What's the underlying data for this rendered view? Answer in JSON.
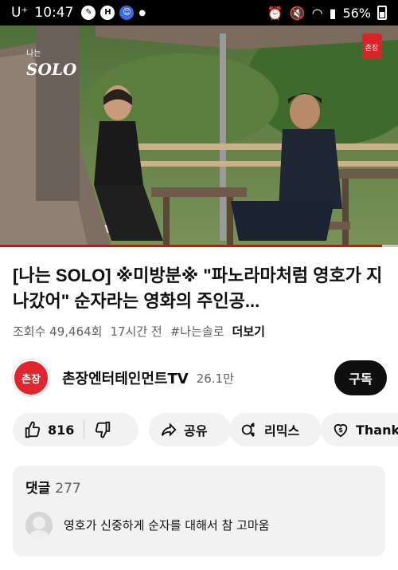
{
  "status_bar": {
    "carrier": "U⁺",
    "time": "10:47",
    "battery": "56%"
  },
  "video": {
    "watermark": "나는 SOLO",
    "logo_text": "촌장",
    "progress_fraction": 0.96
  },
  "title": "[나는 SOLO] ※미방분※ \"파노라마처럼 영호가 지나갔어\" 순자라는 영화의 주인공...",
  "meta": {
    "views": "조회수 49,464회",
    "time_ago": "17시간 전",
    "hashtag": "#나는솔로",
    "more": "더보기"
  },
  "channel": {
    "name": "촌장엔터테인먼트TV",
    "subscribers": "26.1만",
    "avatar_text": "촌장",
    "subscribe": "구독"
  },
  "actions": {
    "like_count": "816",
    "share": "공유",
    "remix": "리믹스",
    "thanks": "Thanks"
  },
  "comments": {
    "label": "댓글",
    "count": "277",
    "top_comment": "영호가 신중하게 순자를 대해서 참 고마움"
  },
  "colors": {
    "accent": "#ff0000",
    "subscribe_bg": "#0f0f0f",
    "pill_bg": "#f2f2f2",
    "channel_logo": "#e0262c"
  }
}
